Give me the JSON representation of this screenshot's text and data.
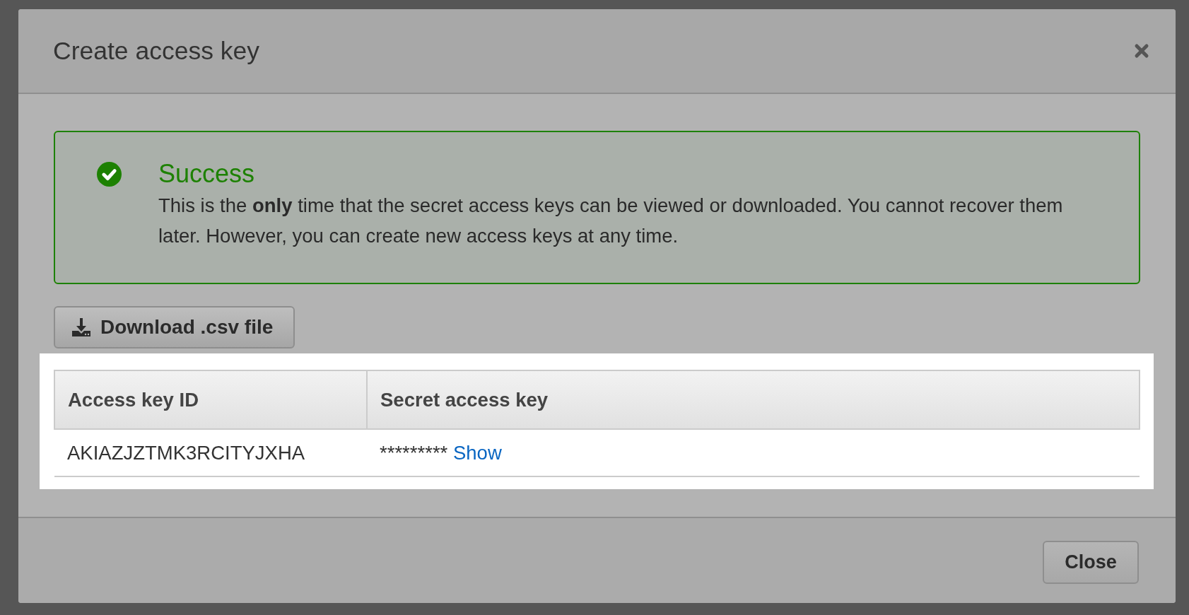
{
  "dialog": {
    "title": "Create access key",
    "alert": {
      "kind": "success",
      "title": "Success",
      "message": "This is the **only** time that the secret access keys can be viewed or downloaded. You cannot recover them later. However, you can create new access keys at any time."
    },
    "download_button": {
      "label": "Download .csv file"
    },
    "table": {
      "columns": [
        "Access key ID",
        "Secret access key"
      ],
      "rows": [
        {
          "access_key_id": "AKIAZJZTMK3RCITYJXHA",
          "secret_access_key": "*********",
          "show_link": "Show"
        }
      ]
    },
    "footer_buttons": [
      "Close"
    ]
  }
}
